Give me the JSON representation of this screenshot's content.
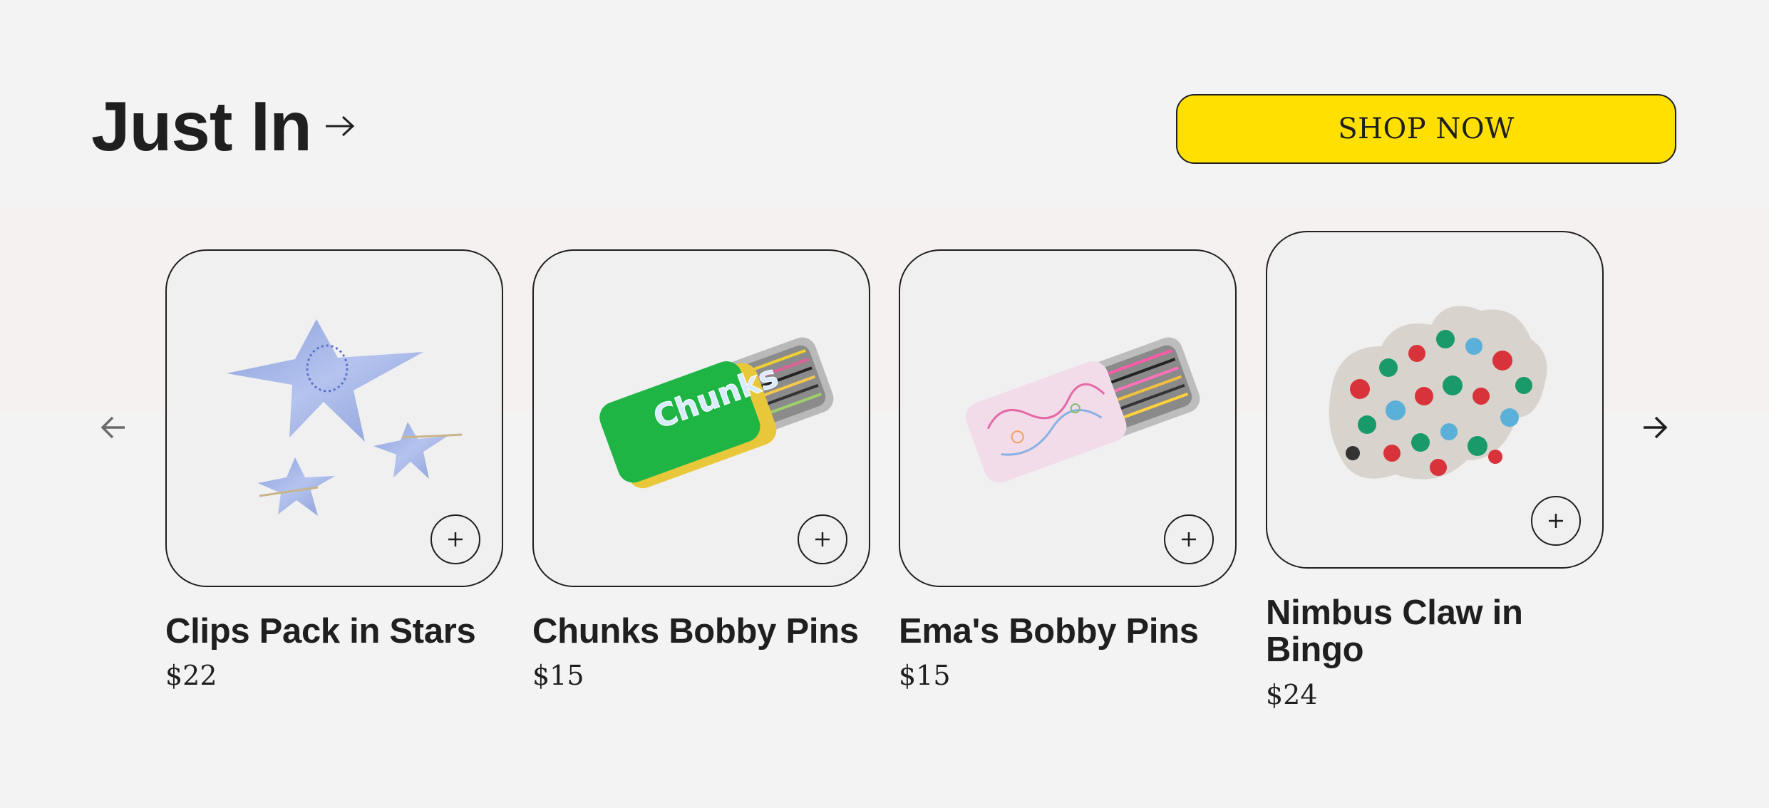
{
  "header": {
    "title": "Just In",
    "title_arrow_icon": "arrow-right-icon",
    "shop_button_label": "SHOP NOW",
    "shop_button_color": "#ffe000"
  },
  "carousel": {
    "prev_icon": "arrow-left-icon",
    "next_icon": "arrow-right-icon",
    "products": [
      {
        "name": "Clips Pack in Stars",
        "price": "$22",
        "image_icon": "star-clips-image",
        "add_icon": "plus-icon"
      },
      {
        "name": "Chunks Bobby Pins",
        "price": "$15",
        "image_icon": "green-tin-bobby-pins-image",
        "tin_label": "Chunks",
        "add_icon": "plus-icon"
      },
      {
        "name": "Ema's Bobby Pins",
        "price": "$15",
        "image_icon": "pink-tin-bobby-pins-image",
        "add_icon": "plus-icon"
      },
      {
        "name": "Nimbus Claw in Bingo",
        "price": "$24",
        "image_icon": "claw-clip-image",
        "add_icon": "plus-icon"
      }
    ]
  },
  "colors": {
    "background": "#f4f3f3",
    "text": "#1f1f1f",
    "accent": "#ffe000",
    "card_background": "#f0f0f0"
  }
}
